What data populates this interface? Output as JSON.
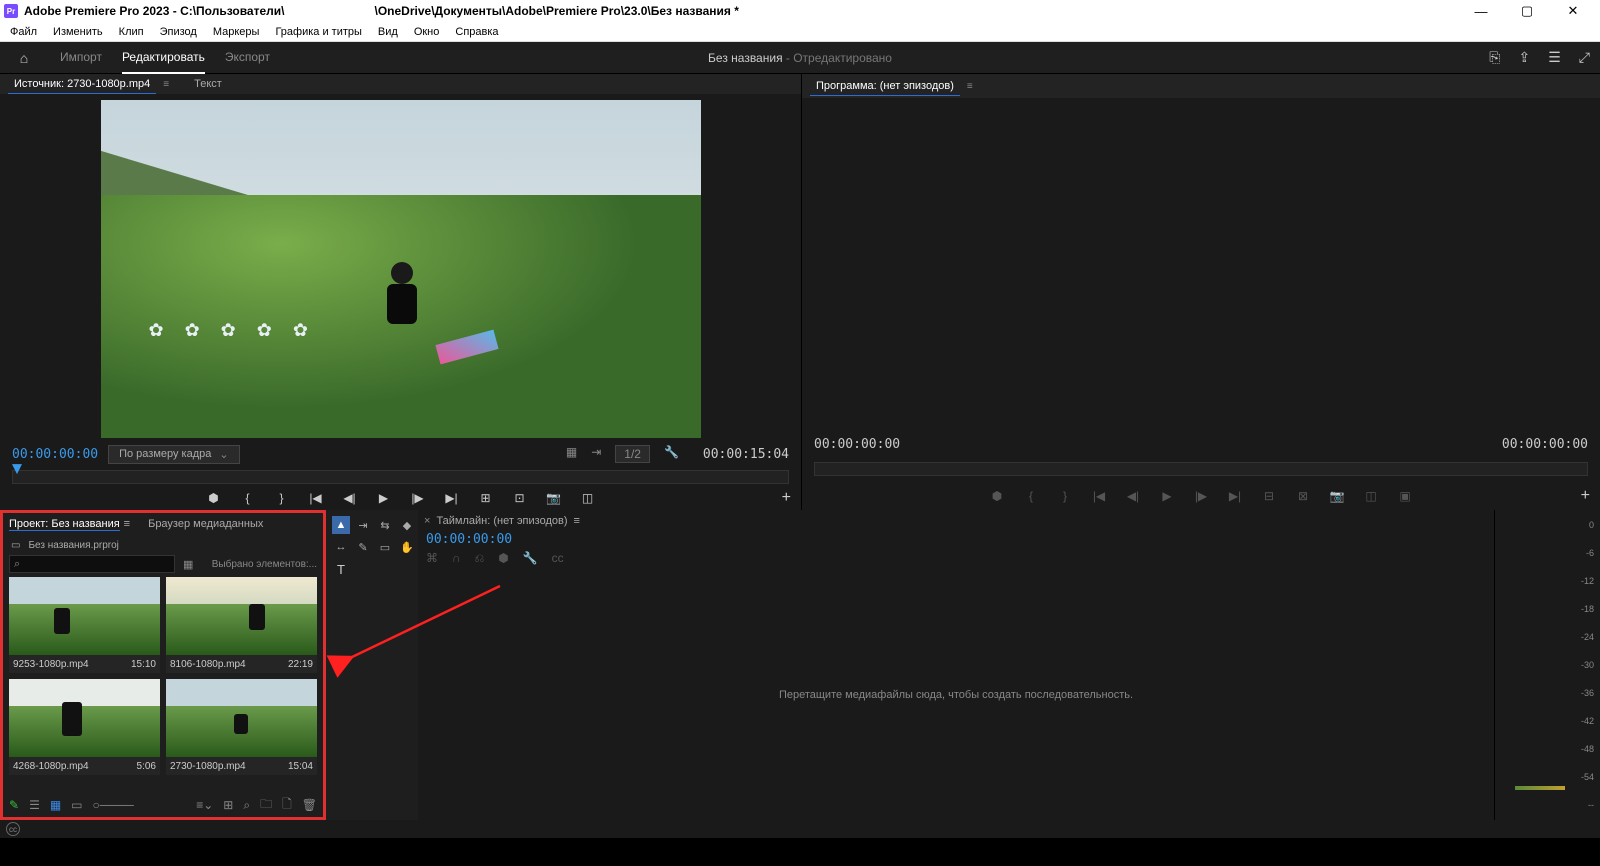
{
  "titlebar": {
    "app_short": "Pr",
    "title_prefix": "Adobe Premiere Pro 2023 - C:\\Пользователи\\",
    "title_suffix": "\\OneDrive\\Документы\\Adobe\\Premiere Pro\\23.0\\Без названия *"
  },
  "menubar": [
    "Файл",
    "Изменить",
    "Клип",
    "Эпизод",
    "Маркеры",
    "Графика и титры",
    "Вид",
    "Окно",
    "Справка"
  ],
  "workspace": {
    "tabs": [
      "Импорт",
      "Редактировать",
      "Экспорт"
    ],
    "active": 1,
    "center_title": "Без названия",
    "center_suffix": " - Отредактировано"
  },
  "source": {
    "tab_label": "Источник: 2730-1080p.mp4",
    "tab_text": "Текст",
    "tc_in": "00:00:00:00",
    "fit_label": "По размеру кадра",
    "res_label": "1/2",
    "tc_out": "00:00:15:04"
  },
  "program": {
    "tab_label": "Программа: (нет эпизодов)",
    "tc_in": "00:00:00:00",
    "tc_out": "00:00:00:00"
  },
  "project": {
    "tab_project": "Проект: Без названия",
    "tab_browser": "Браузер медиаданных",
    "filename": "Без названия.prproj",
    "selected_text": "Выбрано элементов:...",
    "clips": [
      {
        "name": "9253-1080p.mp4",
        "dur": "15:10"
      },
      {
        "name": "8106-1080p.mp4",
        "dur": "22:19"
      },
      {
        "name": "4268-1080p.mp4",
        "dur": "5:06"
      },
      {
        "name": "2730-1080p.mp4",
        "dur": "15:04"
      }
    ]
  },
  "timeline": {
    "tab_label": "Таймлайн: (нет эпизодов)",
    "tc": "00:00:00:00",
    "empty_msg": "Перетащите медиафайлы сюда, чтобы создать последовательность."
  },
  "meter_ticks": [
    "0",
    "-6",
    "-12",
    "-18",
    "-24",
    "-30",
    "-36",
    "-42",
    "-48",
    "-54",
    "--"
  ]
}
